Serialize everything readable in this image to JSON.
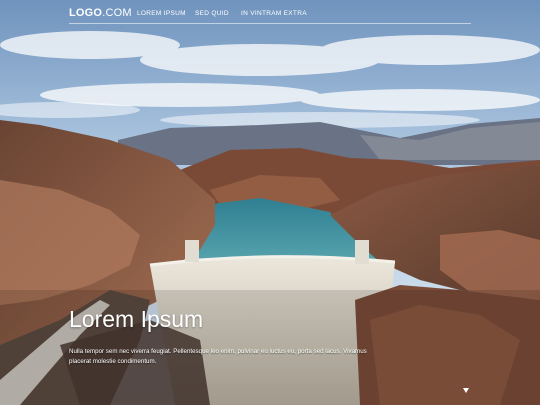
{
  "header": {
    "logo_bold": "LOGO",
    "logo_thin": ".COM",
    "nav": [
      {
        "label": "LOREM IPSUM"
      },
      {
        "label": "SED QUID"
      },
      {
        "label": "IN VINTRAM EXTRA"
      }
    ]
  },
  "hero": {
    "title": "Lorem Ipsum",
    "text": "Nulla tempor sem nec viverra feugiat. Pellentesque leo enim, pulvinar eu luctus eu, porta sed lacus. Vivamus placerat molestie condimentum."
  },
  "icons": {
    "scroll": "chevron-down-icon"
  },
  "colors": {
    "sky_top": "#8fb0d4",
    "sky_bottom": "#dde9f3",
    "water": "#3e8c9c",
    "dam": "#d7d0c2",
    "rock": "#7a4f3c"
  }
}
